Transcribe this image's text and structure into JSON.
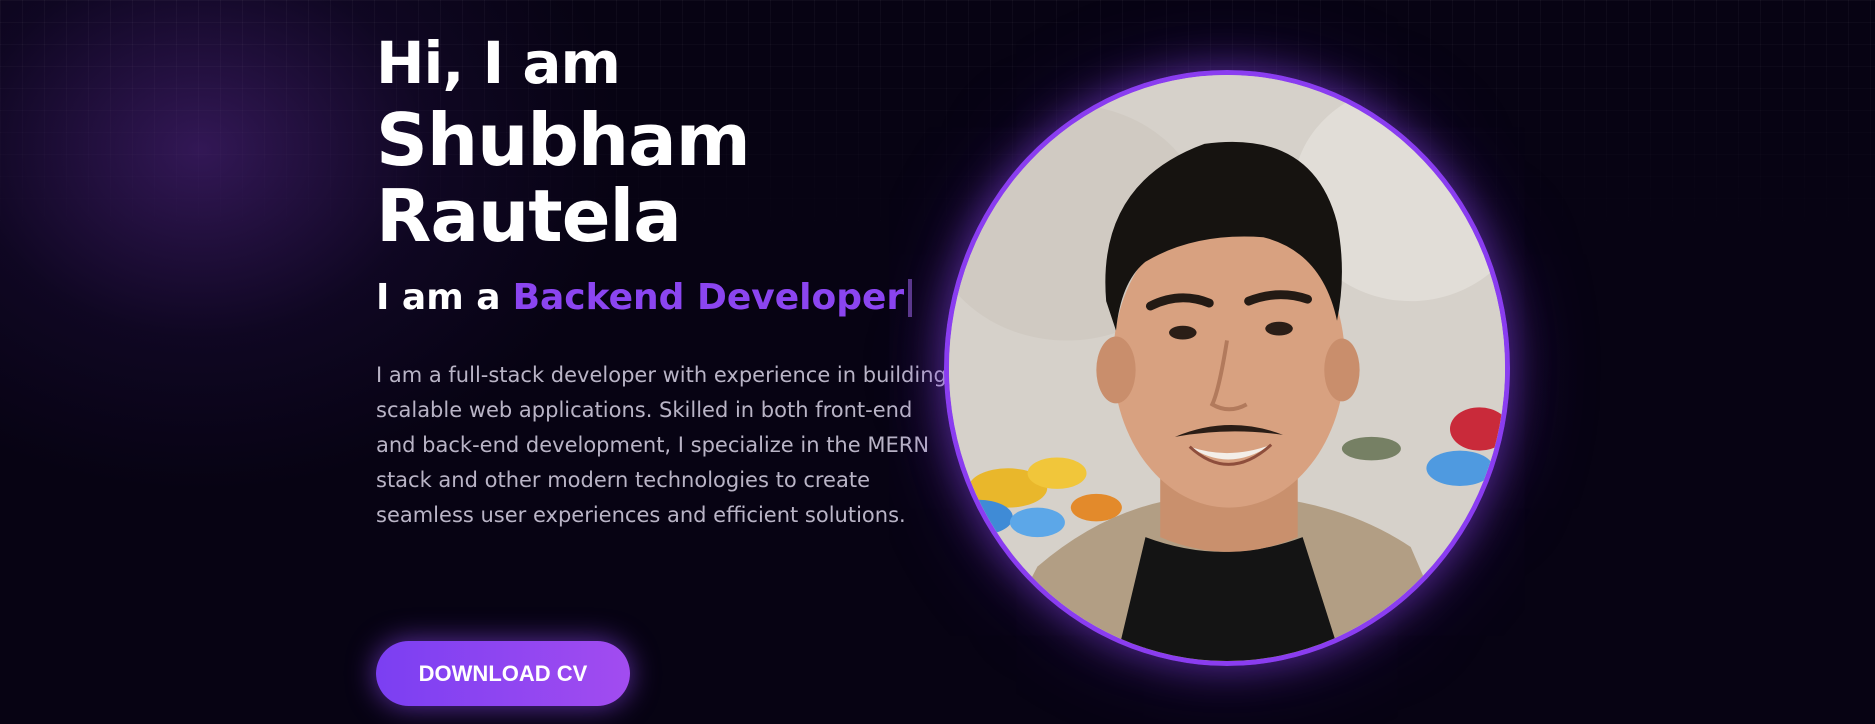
{
  "hero": {
    "greeting": "Hi, I am",
    "name": "Shubham Rautela",
    "role_prefix": "I am a",
    "role_highlight": "Backend Developer",
    "bio": "I am a full-stack developer with experience in building scalable web applications. Skilled in both front-end and back-end development, I specialize in the MERN stack and other modern technologies to create seamless user experiences and efficient solutions.",
    "cta_label": "DOWNLOAD CV"
  },
  "colors": {
    "background": "#070313",
    "accent": "#8b45f0",
    "button_gradient_start": "#7b3ff2",
    "button_gradient_end": "#a24cf0",
    "body_text": "#b9b4c6"
  },
  "icons": {
    "photo": "profile-photo"
  }
}
